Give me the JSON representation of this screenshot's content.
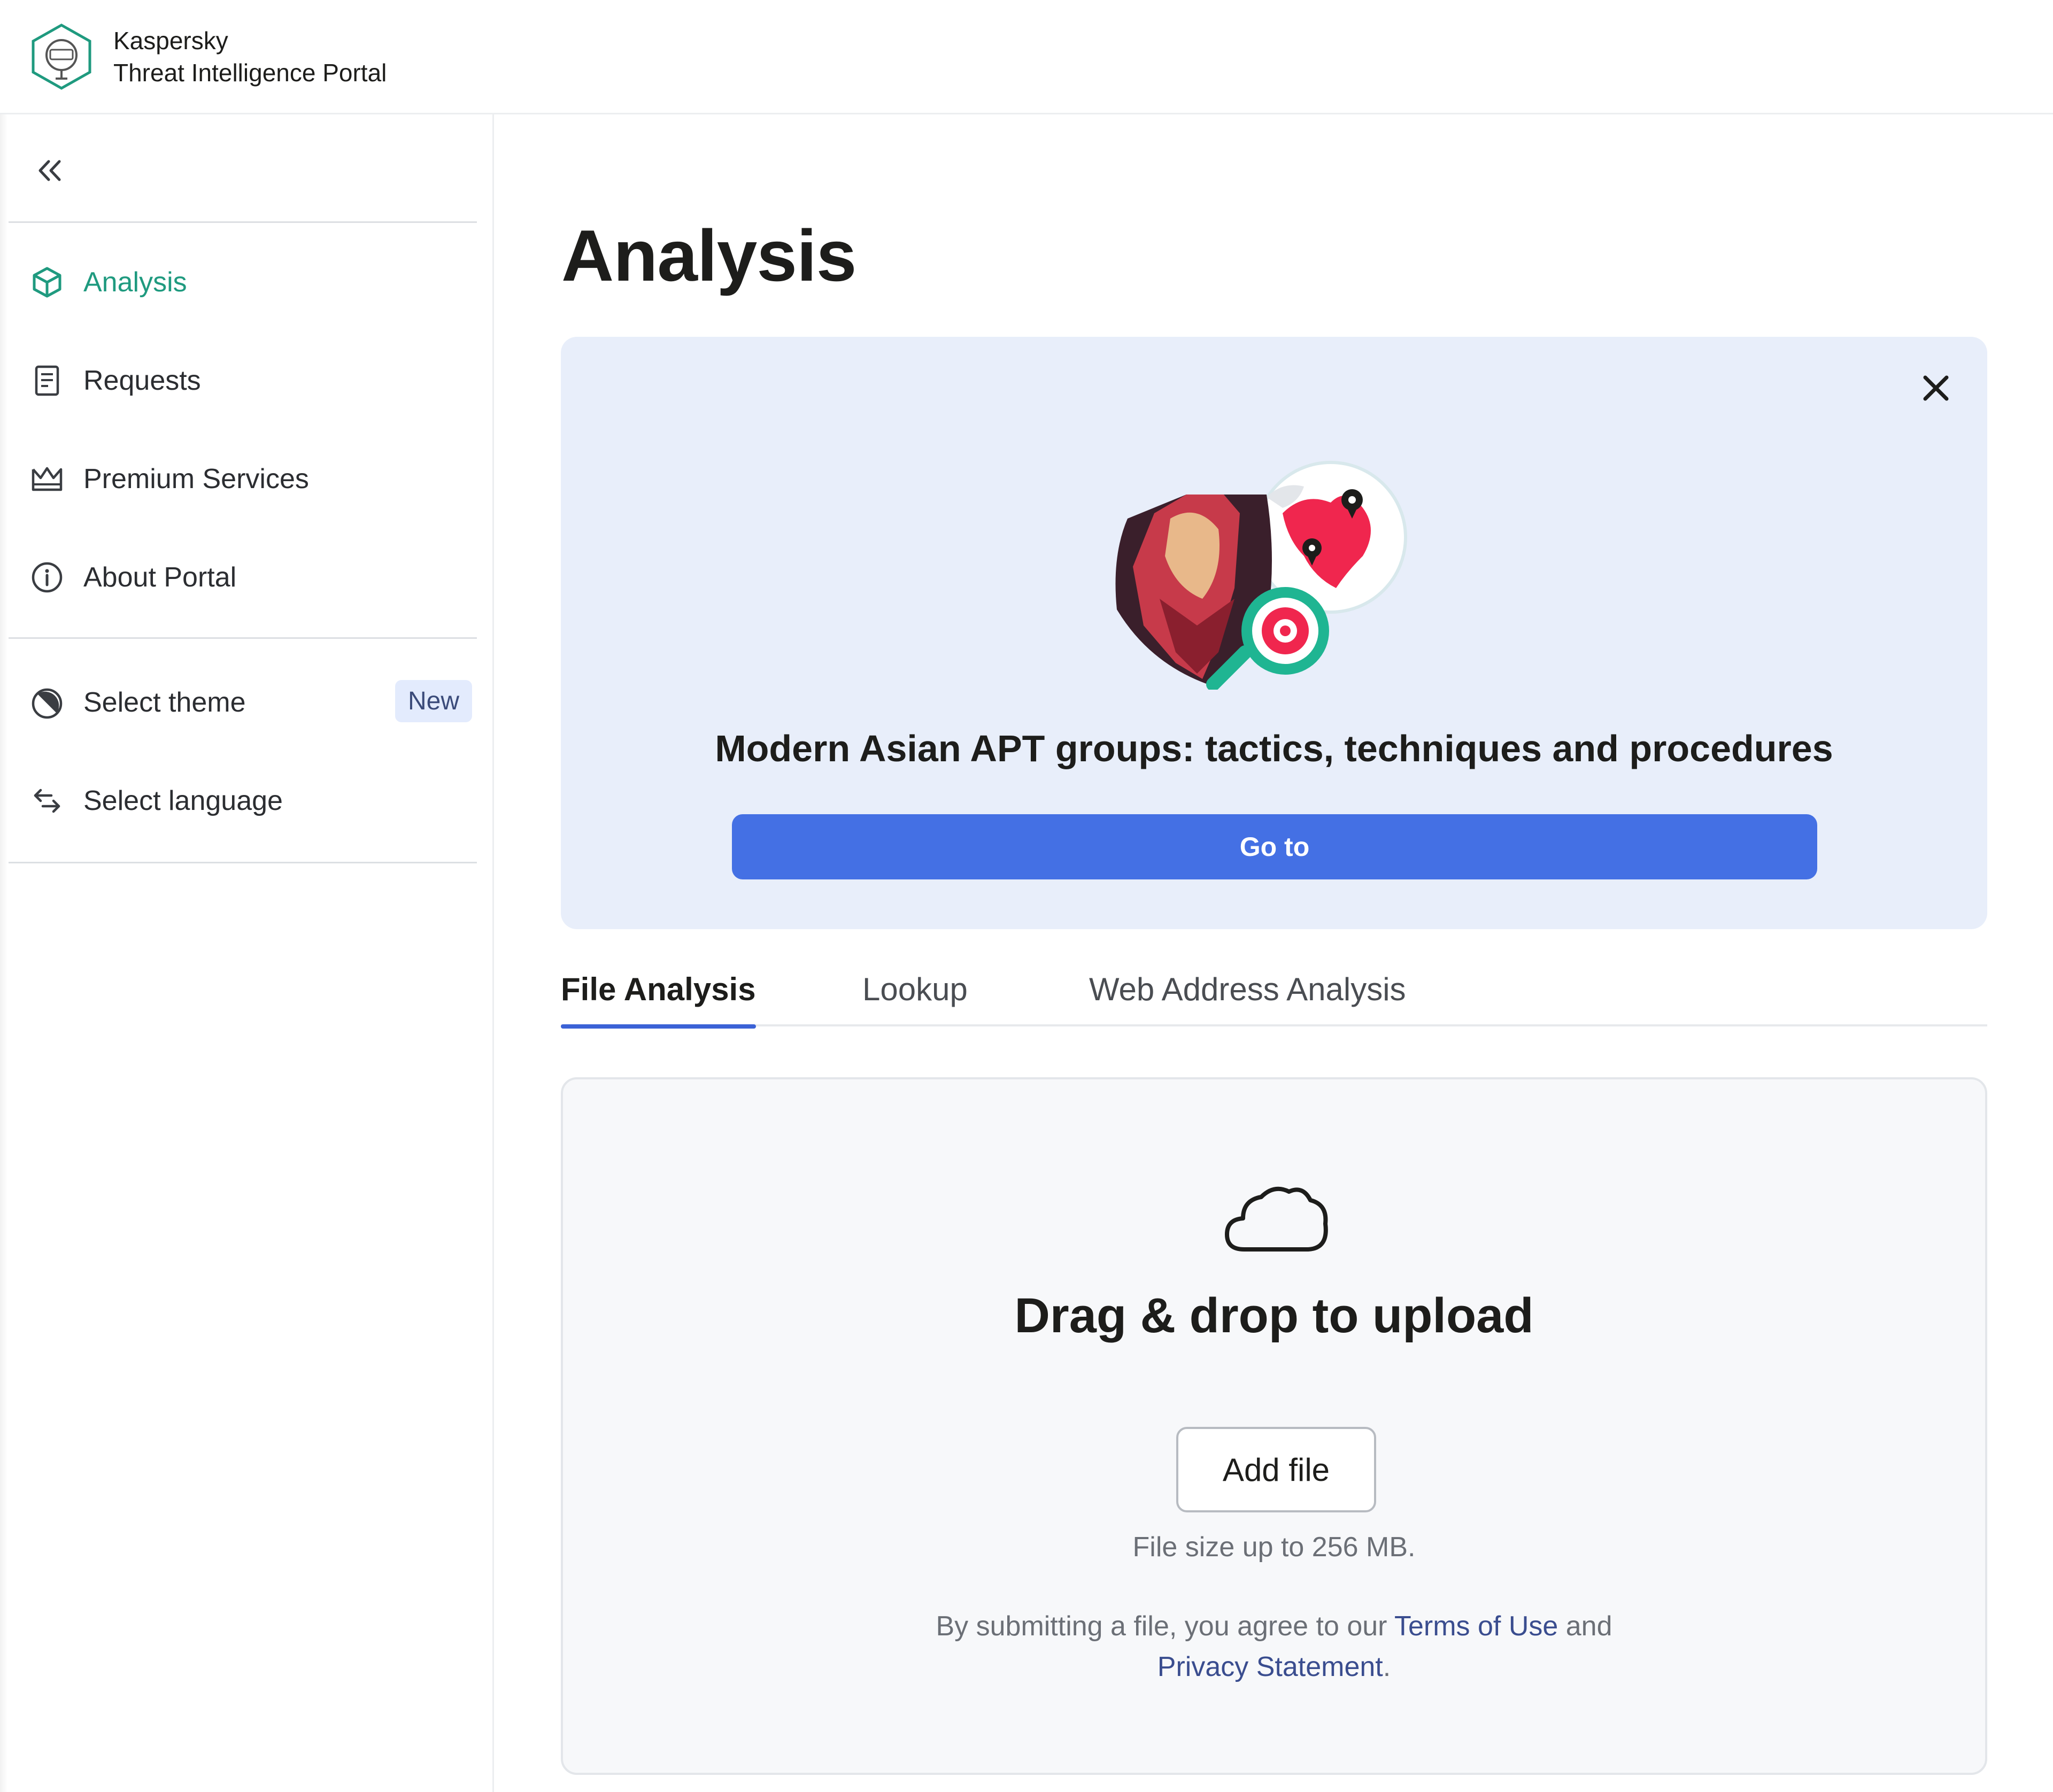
{
  "header": {
    "brand_line1": "Kaspersky",
    "brand_line2": "Threat Intelligence Portal",
    "logo_icon": "kaspersky-hexagon-logo"
  },
  "sidebar": {
    "collapse_icon": "double-chevron-left-icon",
    "items": [
      {
        "label": "Analysis",
        "icon": "cube-icon",
        "active": true
      },
      {
        "label": "Requests",
        "icon": "document-icon",
        "active": false
      },
      {
        "label": "Premium Services",
        "icon": "crown-icon",
        "active": false
      },
      {
        "label": "About Portal",
        "icon": "info-icon",
        "active": false
      }
    ],
    "settings": [
      {
        "label": "Select theme",
        "icon": "theme-icon",
        "badge": "New"
      },
      {
        "label": "Select language",
        "icon": "language-arrows-icon"
      }
    ]
  },
  "main": {
    "title": "Analysis",
    "banner": {
      "title": "Modern Asian APT groups: tactics, techniques and procedures",
      "button_label": "Go to",
      "close_icon": "close-icon"
    },
    "tabs": [
      {
        "label": "File Analysis",
        "active": true
      },
      {
        "label": "Lookup",
        "active": false
      },
      {
        "label": "Web Address Analysis",
        "active": false
      }
    ],
    "upload": {
      "icon": "cloud-icon",
      "title": "Drag & drop to upload",
      "button_label": "Add file",
      "size_note": "File size up to 256 MB.",
      "terms_prefix": "By submitting a file, you agree to our",
      "terms_link": "Terms of Use",
      "terms_and": "and",
      "privacy_link": "Privacy Statement",
      "terms_suffix": "."
    }
  },
  "colors": {
    "accent_green": "#1f9a7f",
    "primary_blue": "#4470e4",
    "banner_bg": "#e8eefa",
    "badge_bg": "#e3ebfd"
  }
}
